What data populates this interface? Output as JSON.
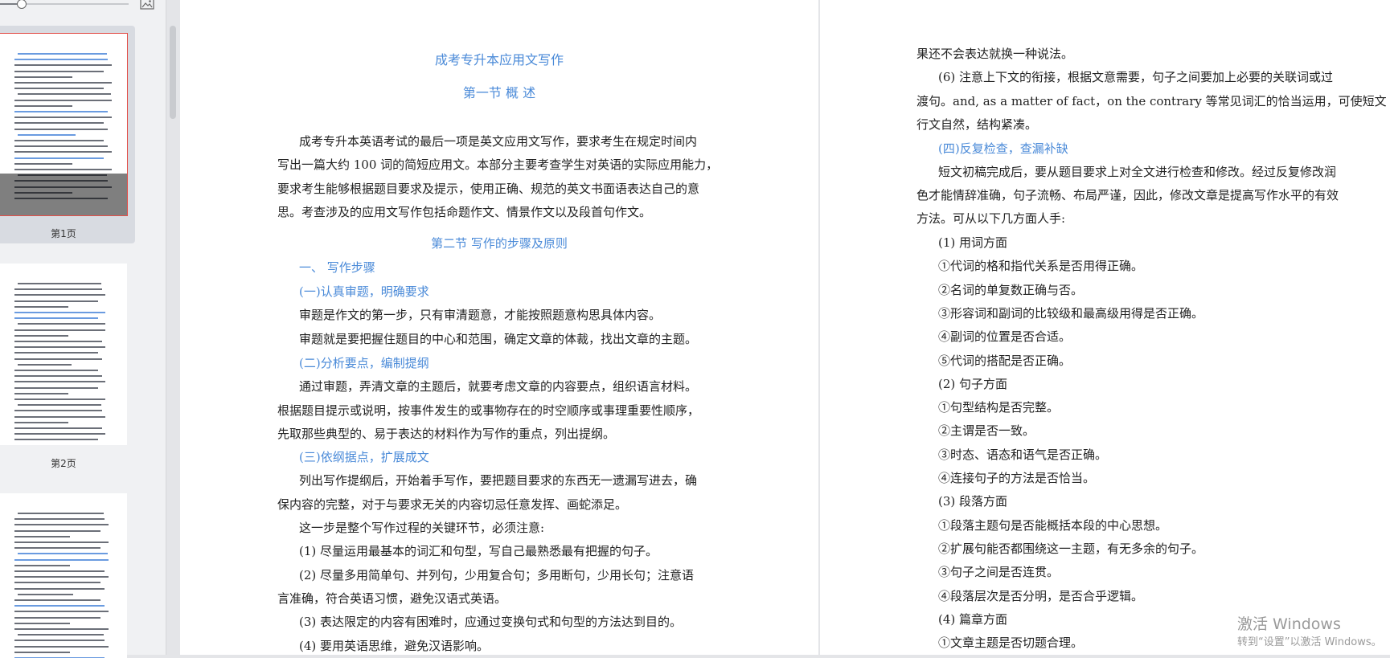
{
  "sidebar": {
    "zoom_value": 0.16,
    "thumbnails": [
      {
        "label": "第1页"
      },
      {
        "label": "第2页"
      }
    ]
  },
  "page1": {
    "title": "成考专升本应用文写作",
    "section1": "第一节  概  述",
    "intro": [
      "成考专升本英语考试的最后一项是英文应用文写作，要求考生在规定时间内",
      "写出一篇大约 100 词的简短应用文。本部分主要考查学生对英语的实际应用能力，",
      "要求考生能够根据题目要求及提示，使用正确、规范的英文书面语表达自己的意",
      "思。考查涉及的应用文写作包括命题作文、情景作文以及段首句作文。"
    ],
    "section2": "第二节  写作的步骤及原则",
    "h_steps": "一、  写作步骤",
    "h1": "(一)认真审题，明确要求",
    "h1_lines": [
      "审题是作文的第一步，只有审清题意，才能按照题意构思具体内容。",
      "审题就是要把握住题目的中心和范围，确定文章的体裁，找出文章的主题。"
    ],
    "h2": "(二)分析要点，编制提纲",
    "h2_lines": [
      "通过审题，弄清文章的主题后，就要考虑文章的内容要点，组织语言材料。",
      "根据题目提示或说明，按事件发生的或事物存在的时空顺序或事理重要性顺序，",
      "先取那些典型的、易于表达的材料作为写作的重点，列出提纲。"
    ],
    "h3": "(三)依纲据点，扩展成文",
    "h3_lines": [
      "列出写作提纲后，开始着手写作，要把题目要求的东西无一遗漏写进去，确",
      "保内容的完整，对于与要求无关的内容切忌任意发挥、画蛇添足。",
      "这一步是整个写作过程的关键环节，必须注意:",
      "(1)  尽量运用最基本的词汇和句型，写自己最熟悉最有把握的句子。",
      "(2)  尽量多用简单句、并列句，少用复合句；多用断句，少用长句；注意语",
      "言准确，符合英语习惯，避免汉语式英语。",
      "(3)  表达限定的内容有困难时，应通过变换句式和句型的方法达到目的。",
      "(4)  要用英语思维，避免汉语影响。"
    ]
  },
  "page2": {
    "top_lines": [
      "果还不会表达就换一种说法。",
      "(6)  注意上下文的衔接，根据文意需要，句子之间要加上必要的关联词或过",
      "渡句。and, as a matter of fact，on the contrary 等常见词汇的恰当运用，可使短文",
      "行文自然，结构紧凑。"
    ],
    "h4": "(四)反复检查，查漏补缺",
    "h4_lines": [
      "短文初稿完成后，要从题目要求上对全文进行检查和修改。经过反复修改润",
      "色才能情辞准确，句子流畅、布局严谨，因此，修改文章是提高写作水平的有效",
      "方法。可从以下几方面人手:"
    ],
    "checklist": [
      "(1)  用词方面",
      "①代词的格和指代关系是否用得正确。",
      "②名词的单复数正确与否。",
      "③形容词和副词的比较级和最高级用得是否正确。",
      "④副词的位置是否合适。",
      "⑤代词的搭配是否正确。",
      "(2)  句子方面",
      "①句型结构是否完整。",
      "②主谓是否一致。",
      "③时态、语态和语气是否正确。",
      "④连接句子的方法是否恰当。",
      "(3)  段落方面",
      "①段落主题句是否能概括本段的中心思想。",
      "②扩展句能否都围绕这一主题，有无多余的句子。",
      "③句子之间是否连贯。",
      "④段落层次是否分明，是否合乎逻辑。",
      "(4)  篇章方面",
      "①文章主题是否切题合理。"
    ]
  },
  "watermark": {
    "title": "激活 Windows",
    "subtitle": "转到“设置”以激活 Windows。"
  },
  "colors": {
    "heading_blue": "#4a8ad8",
    "selected_thumb_border": "#e2504a"
  }
}
